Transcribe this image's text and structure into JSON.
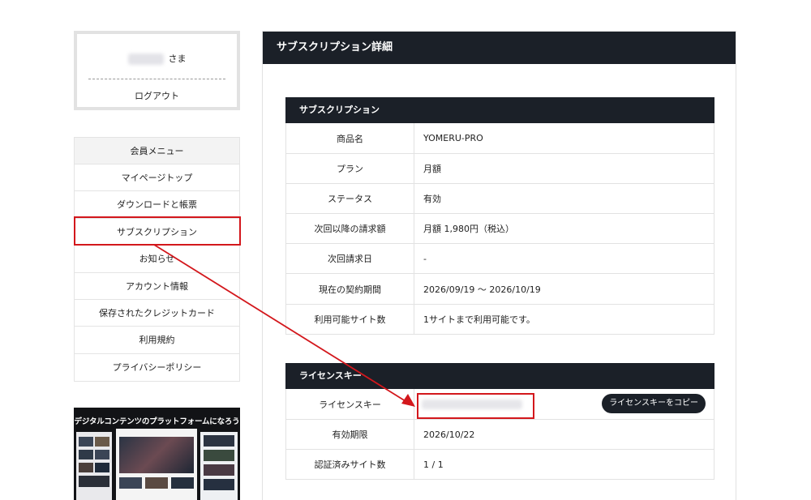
{
  "user": {
    "honorific": "さま",
    "logout": "ログアウト"
  },
  "menu": {
    "header": "会員メニュー",
    "items": [
      {
        "label": "マイページトップ"
      },
      {
        "label": "ダウンロードと帳票"
      },
      {
        "label": "サブスクリプション"
      },
      {
        "label": "お知らせ"
      },
      {
        "label": "アカウント情報"
      },
      {
        "label": "保存されたクレジットカード"
      },
      {
        "label": "利用規約"
      },
      {
        "label": "プライバシーポリシー"
      }
    ]
  },
  "banner": {
    "title": "デジタルコンテンツのプラットフォームになろう"
  },
  "page": {
    "title": "サブスクリプション詳細"
  },
  "subscription": {
    "header": "サブスクリプション",
    "rows": [
      {
        "label": "商品名",
        "value": "YOMERU-PRO"
      },
      {
        "label": "プラン",
        "value": "月額"
      },
      {
        "label": "ステータス",
        "value": "有効"
      },
      {
        "label": "次回以降の請求額",
        "value": "月額 1,980円（税込）"
      },
      {
        "label": "次回請求日",
        "value": "-"
      },
      {
        "label": "現在の契約期間",
        "value": "2026/09/19 〜 2026/10/19"
      },
      {
        "label": "利用可能サイト数",
        "value": "1サイトまで利用可能です。"
      }
    ]
  },
  "license": {
    "header": "ライセンスキー",
    "key_label": "ライセンスキー",
    "copy_button": "ライセンスキーをコピー",
    "expiry_label": "有効期限",
    "expiry_value": "2026/10/22",
    "sites_label": "認証済みサイト数",
    "sites_value": "1 / 1"
  },
  "annotation_color": "#d3171c"
}
